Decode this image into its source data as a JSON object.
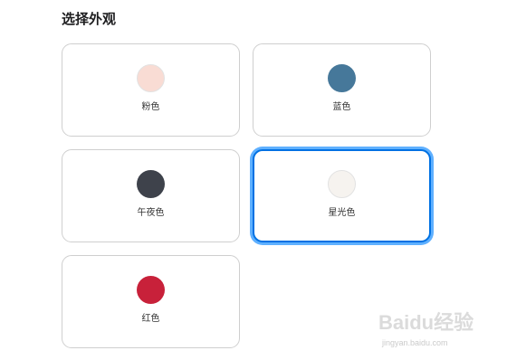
{
  "page": {
    "title": "选择外观"
  },
  "options": [
    {
      "label": "粉色",
      "color": "#f9dcd4",
      "light": true,
      "selected": false
    },
    {
      "label": "蓝色",
      "color": "#46789a",
      "light": false,
      "selected": false
    },
    {
      "label": "午夜色",
      "color": "#3e424b",
      "light": false,
      "selected": false
    },
    {
      "label": "星光色",
      "color": "#f6f3ef",
      "light": true,
      "selected": true
    },
    {
      "label": "红色",
      "color": "#c8213a",
      "light": false,
      "selected": false
    }
  ],
  "watermark": {
    "brand": "Baidu经验",
    "url": "jingyan.baidu.com"
  },
  "colors": {
    "accent": "#0071e3",
    "focus_ring": "#5fb0ff"
  }
}
